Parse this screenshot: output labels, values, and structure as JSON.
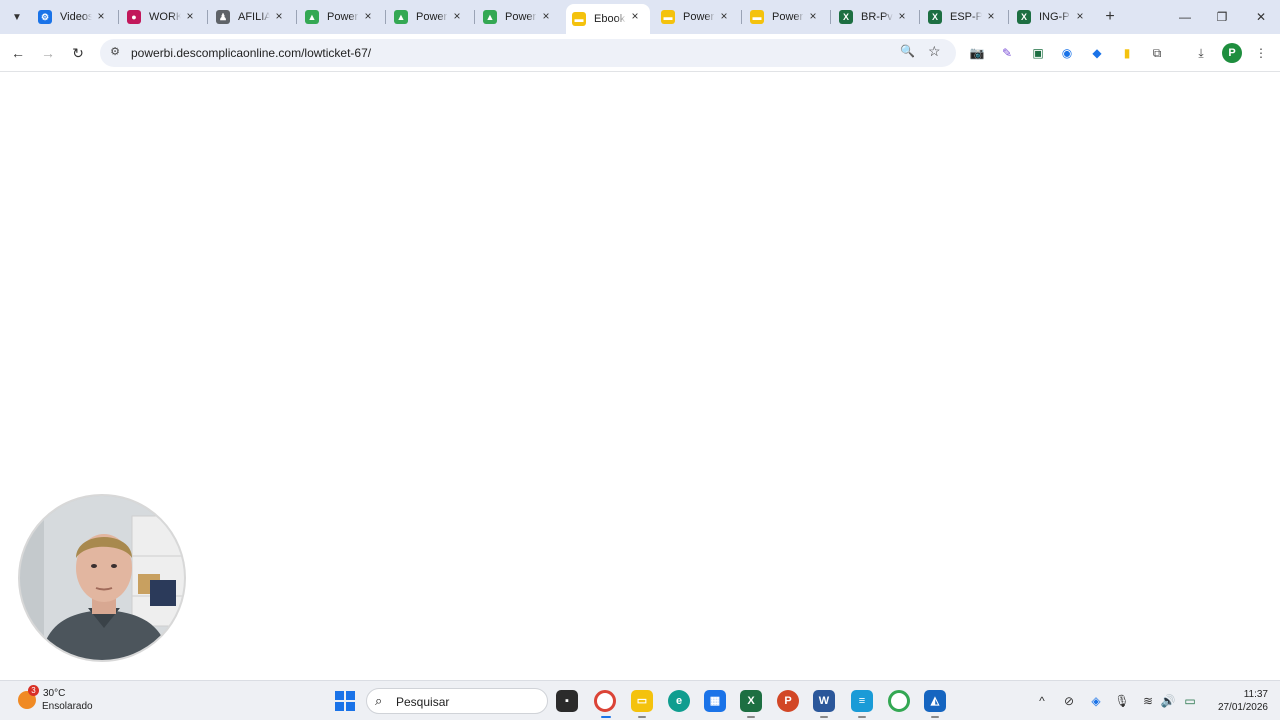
{
  "browser": {
    "tabs": [
      {
        "title": "Videos",
        "favicon": "gear-favicon",
        "color": "#1a73e8"
      },
      {
        "title": "WORK",
        "favicon": "circle-favicon",
        "color": "#c2185b"
      },
      {
        "title": "AFILIA",
        "favicon": "person-favicon",
        "color": "#5f6368"
      },
      {
        "title": "Power",
        "favicon": "google-drive-favicon",
        "color": "#34a853"
      },
      {
        "title": "Power",
        "favicon": "google-drive-favicon",
        "color": "#34a853"
      },
      {
        "title": "Power",
        "favicon": "google-drive-favicon",
        "color": "#34a853"
      },
      {
        "title": "Ebook",
        "favicon": "site-favicon",
        "color": "#f4c20d",
        "active": true
      },
      {
        "title": "Power",
        "favicon": "site-favicon",
        "color": "#f4c20d"
      },
      {
        "title": "Power",
        "favicon": "site-favicon",
        "color": "#f4c20d"
      },
      {
        "title": "BR-Pv",
        "favicon": "excel-favicon",
        "color": "#1d6f42"
      },
      {
        "title": "ESP-P",
        "favicon": "excel-favicon",
        "color": "#1d6f42"
      },
      {
        "title": "ING-P",
        "favicon": "excel-favicon",
        "color": "#1d6f42"
      }
    ],
    "close_glyph": "×",
    "new_tab_glyph": "+",
    "url": "powerbi.descomplicaonline.com/lowticket-67/",
    "profile_initial": "P"
  },
  "taskbar": {
    "weather": {
      "badge": "3",
      "temp": "30°C",
      "desc": "Ensolarado"
    },
    "search_placeholder": "Pesquisar",
    "clock_time": "11:37",
    "clock_date": "27/01/2026"
  },
  "colors": {
    "tabstrip": "#dfe5f3",
    "accent": "#1a73e8"
  }
}
